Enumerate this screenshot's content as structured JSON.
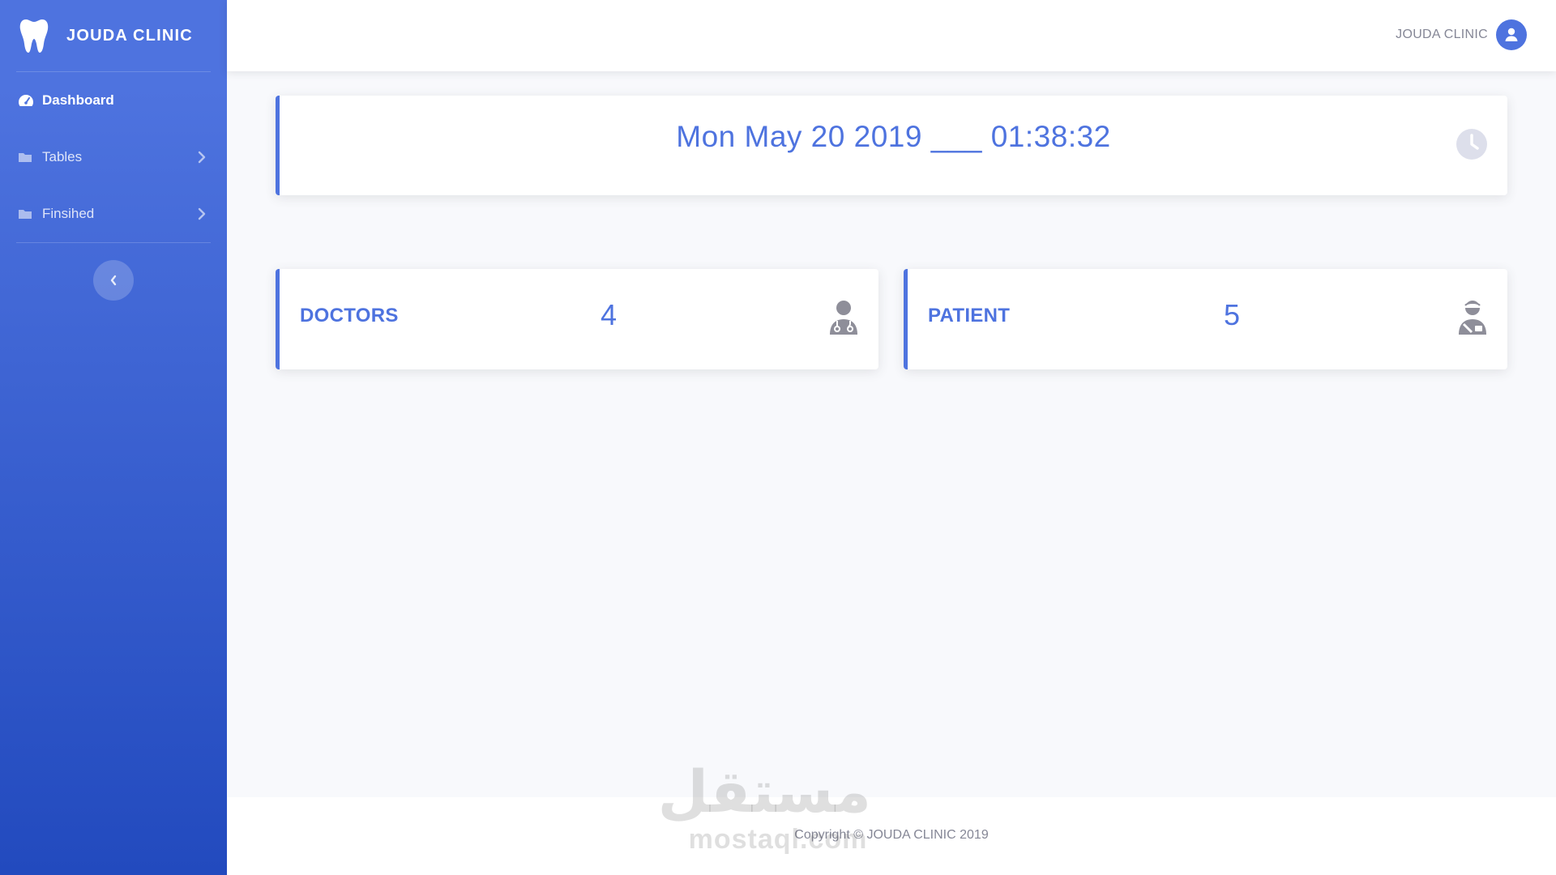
{
  "brand": {
    "name": "JOUDA CLINIC",
    "icon": "tooth-icon"
  },
  "sidebar": {
    "items": [
      {
        "label": "Dashboard",
        "icon": "tachometer-icon",
        "active": true,
        "has_children": false
      },
      {
        "label": "Tables",
        "icon": "folder-icon",
        "active": false,
        "has_children": true
      },
      {
        "label": "Finsihed",
        "icon": "folder-icon",
        "active": false,
        "has_children": true
      }
    ],
    "toggle_icon": "chevron-left-icon"
  },
  "topbar": {
    "user_name": "JOUDA CLINIC",
    "avatar_icon": "user-circle-icon"
  },
  "clock": {
    "text": "Mon May 20 2019 ___ 01:38:32",
    "icon": "clock-icon"
  },
  "stats": {
    "doctors": {
      "label": "DOCTORS",
      "value": "4",
      "icon": "user-doctor-icon"
    },
    "patient": {
      "label": "PATIENT",
      "value": "5",
      "icon": "user-injured-icon"
    }
  },
  "footer": {
    "text": "Copyright © JOUDA CLINIC 2019"
  },
  "watermark": {
    "arabic": "مستقل",
    "latin": "mostaql.com"
  },
  "colors": {
    "primary": "#4e73df",
    "sidebar_end": "#224abe",
    "muted": "#858796",
    "icon_gray": "#8e8e99",
    "background": "#f8f9fc"
  }
}
